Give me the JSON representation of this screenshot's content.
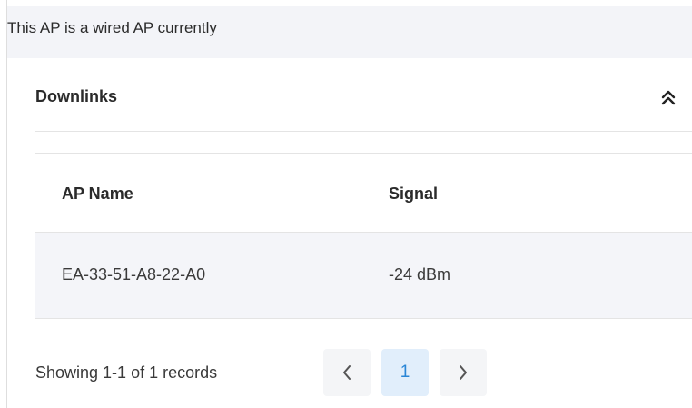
{
  "banner": {
    "message": "This AP is a wired AP currently"
  },
  "downlinks": {
    "title": "Downlinks",
    "collapse_icon": "double-chevron-up-icon",
    "columns": [
      "AP Name",
      "Signal"
    ],
    "rows": [
      {
        "ap_name": "EA-33-51-A8-22-A0",
        "signal": "-24 dBm"
      }
    ]
  },
  "pagination": {
    "info": "Showing 1-1 of 1 records",
    "prev_icon": "chevron-left-icon",
    "current_page": "1",
    "next_icon": "chevron-right-icon"
  },
  "colors": {
    "banner_bg": "#f3f4f8",
    "row_bg": "#f4f5f9",
    "active_page_bg": "#e1eefb",
    "active_page_text": "#2a86d6"
  }
}
